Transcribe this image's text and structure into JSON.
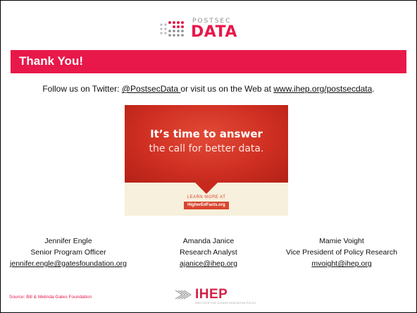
{
  "logo": {
    "top": "POSTSEC",
    "bottom": "DATA",
    "icon": "dot-grid-icon",
    "color": "#e8184a"
  },
  "banner": {
    "title": "Thank You!",
    "color": "#e8184a"
  },
  "follow": {
    "prefix": "Follow us on Twitter: ",
    "twitter": "@PostsecData ",
    "middle": "or visit us on the Web at ",
    "web": "www.ihep.org/postsecdata",
    "suffix": "."
  },
  "ad": {
    "line1": "It’s time to answer",
    "line2": "the call for better data.",
    "learn": "LEARN MORE AT",
    "url": "HigherEdFacts.org"
  },
  "contacts": [
    {
      "name": "Jennifer Engle",
      "title": "Senior Program Officer",
      "email": "jennifer.engle@gatesfoundation.org"
    },
    {
      "name": "Amanda Janice",
      "title": "Research Analyst",
      "email": "ajanice@ihep.org"
    },
    {
      "name": "Mamie Voight",
      "title": "Vice President of Policy Research",
      "email": "mvoight@ihep.org"
    }
  ],
  "source": "Source: Bill & Melinda Gates Foundation",
  "ihep": {
    "word": "IHEP",
    "tagline": "INSTITUTE FOR HIGHER EDUCATION POLICY",
    "icon": "ihep-logo-icon"
  }
}
